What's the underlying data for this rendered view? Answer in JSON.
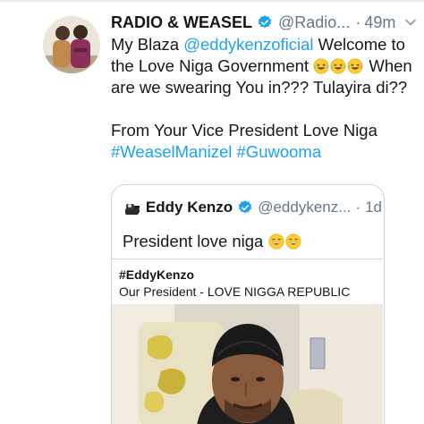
{
  "tweet": {
    "author_name": "RADIO & WEASEL",
    "handle": "@Radio...",
    "separator": "·",
    "time": "49m",
    "line1_prefix": "My Blaza ",
    "mention": "@eddykenzoficial",
    "line1_suffix": " Welcome to the Love Niga Government ",
    "line2": " When are we swearing You in??? Tulayira di??",
    "line3": "From Your Vice President Love Niga",
    "hashtag1": "#WeaselManizel",
    "hashtag2": "#Guwooma"
  },
  "quoted": {
    "author_name": "Eddy Kenzo",
    "handle": "@eddykenz...",
    "separator": "·",
    "time": "1d",
    "text": "President love niga ",
    "link_title": "#EddyKenzo",
    "link_subtitle": "Our President - LOVE NIGGA REPUBLIC"
  },
  "icons": {
    "verified": "verified-badge-icon",
    "more": "chevron-down-icon",
    "laughing": "laughing-tears-emoji",
    "grinning": "grinning-emoji"
  },
  "colors": {
    "link": "#1da1f2",
    "secondary_text": "#657786",
    "border": "#ccd6dd",
    "verified": "#1da1f2"
  }
}
